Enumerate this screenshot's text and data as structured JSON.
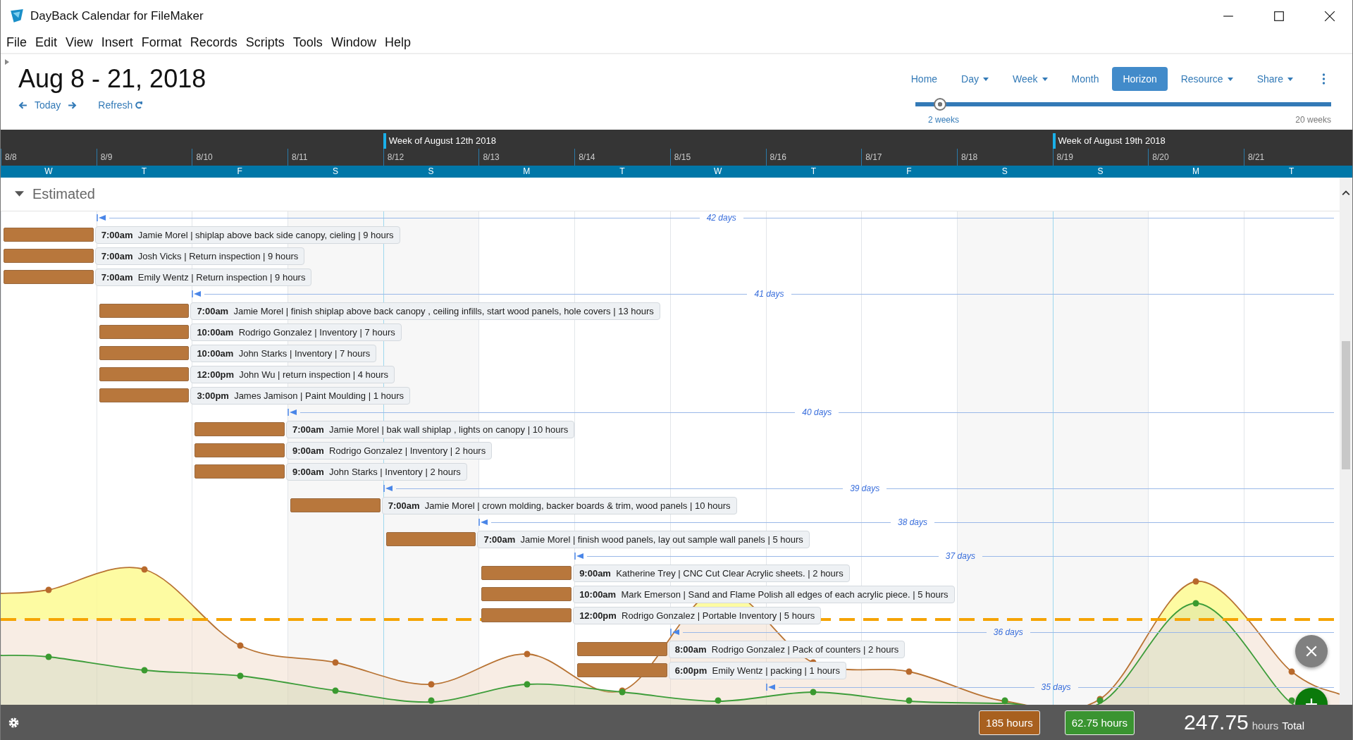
{
  "window": {
    "title": "DayBack Calendar for FileMaker"
  },
  "menu": [
    "File",
    "Edit",
    "View",
    "Insert",
    "Format",
    "Records",
    "Scripts",
    "Tools",
    "Window",
    "Help"
  ],
  "header": {
    "title": "Aug 8 - 21, 2018",
    "today": "Today",
    "refresh": "Refresh"
  },
  "views": [
    {
      "label": "Home",
      "dropdown": false,
      "selected": false
    },
    {
      "label": "Day",
      "dropdown": true,
      "selected": false
    },
    {
      "label": "Week",
      "dropdown": true,
      "selected": false
    },
    {
      "label": "Month",
      "dropdown": false,
      "selected": false
    },
    {
      "label": "Horizon",
      "dropdown": false,
      "selected": true
    },
    {
      "label": "Resource",
      "dropdown": true,
      "selected": false
    },
    {
      "label": "Share",
      "dropdown": true,
      "selected": false
    }
  ],
  "range_slider": {
    "level": 0.06,
    "min_label": "2 weeks",
    "max_label": "20 weeks"
  },
  "days": [
    {
      "date": "8/8",
      "weekday": "W",
      "weekend": false
    },
    {
      "date": "8/9",
      "weekday": "T",
      "weekend": false
    },
    {
      "date": "8/10",
      "weekday": "F",
      "weekend": false
    },
    {
      "date": "8/11",
      "weekday": "S",
      "weekend": true
    },
    {
      "date": "8/12",
      "weekday": "S",
      "weekend": true,
      "week_label": "Week of August 12th 2018"
    },
    {
      "date": "8/13",
      "weekday": "M",
      "weekend": false
    },
    {
      "date": "8/14",
      "weekday": "T",
      "weekend": false
    },
    {
      "date": "8/15",
      "weekday": "W",
      "weekend": false
    },
    {
      "date": "8/16",
      "weekday": "T",
      "weekend": false
    },
    {
      "date": "8/17",
      "weekday": "F",
      "weekend": false
    },
    {
      "date": "8/18",
      "weekday": "S",
      "weekend": true
    },
    {
      "date": "8/19",
      "weekday": "S",
      "weekend": true,
      "week_label": "Week of August 19th 2018"
    },
    {
      "date": "8/20",
      "weekday": "M",
      "weekend": false
    },
    {
      "date": "8/21",
      "weekday": "T",
      "weekend": false
    }
  ],
  "section": {
    "title": "Estimated",
    "expanded": true
  },
  "groups": [
    {
      "span": "42 days",
      "events": [
        {
          "time": "7:00am",
          "text": "Jamie Morel | shiplap above back side canopy, cieling | 9 hours"
        },
        {
          "time": "7:00am",
          "text": "Josh Vicks | Return inspection | 9 hours"
        },
        {
          "time": "7:00am",
          "text": "Emily Wentz | Return inspection | 9 hours"
        }
      ]
    },
    {
      "span": "41 days",
      "events": [
        {
          "time": "7:00am",
          "text": "Jamie Morel | finish shiplap above back canopy , ceiling infills, start wood panels, hole covers | 13 hours"
        },
        {
          "time": "10:00am",
          "text": "Rodrigo Gonzalez | Inventory | 7 hours"
        },
        {
          "time": "10:00am",
          "text": "John Starks | Inventory | 7 hours"
        },
        {
          "time": "12:00pm",
          "text": "John Wu | return inspection | 4 hours"
        },
        {
          "time": "3:00pm",
          "text": "James Jamison | Paint Moulding | 1 hours"
        }
      ]
    },
    {
      "span": "40 days",
      "events": [
        {
          "time": "7:00am",
          "text": "Jamie Morel | bak wall shiplap , lights on canopy | 10 hours"
        },
        {
          "time": "9:00am",
          "text": "Rodrigo Gonzalez | Inventory | 2 hours"
        },
        {
          "time": "9:00am",
          "text": "John Starks | Inventory | 2 hours"
        }
      ]
    },
    {
      "span": "39 days",
      "events": [
        {
          "time": "7:00am",
          "text": "Jamie Morel | crown molding, backer boards & trim, wood panels | 10 hours"
        }
      ]
    },
    {
      "span": "38 days",
      "events": [
        {
          "time": "7:00am",
          "text": "Jamie Morel | finish wood panels, lay out sample wall panels | 5 hours"
        }
      ]
    },
    {
      "span": "37 days",
      "events": [
        {
          "time": "9:00am",
          "text": "Katherine Trey | CNC Cut Clear Acrylic sheets. | 2 hours"
        },
        {
          "time": "10:00am",
          "text": "Mark Emerson | Sand and Flame Polish all edges of each acrylic piece. | 5 hours"
        },
        {
          "time": "12:00pm",
          "text": "Rodrigo Gonzalez | Portable Inventory | 5 hours"
        }
      ]
    },
    {
      "span": "36 days",
      "events": [
        {
          "time": "8:00am",
          "text": "Rodrigo Gonzalez | Pack of counters | 2 hours"
        },
        {
          "time": "6:00pm",
          "text": "Emily Wentz | packing | 1 hours"
        }
      ]
    },
    {
      "span": "35 days"
    }
  ],
  "totals": {
    "badges": [
      {
        "value": "185 hours",
        "color": "#a8601f"
      },
      {
        "value": "62.75 hours",
        "color": "#3a9431"
      }
    ],
    "total": "247.75",
    "unit": "hours",
    "label": "Total"
  }
}
